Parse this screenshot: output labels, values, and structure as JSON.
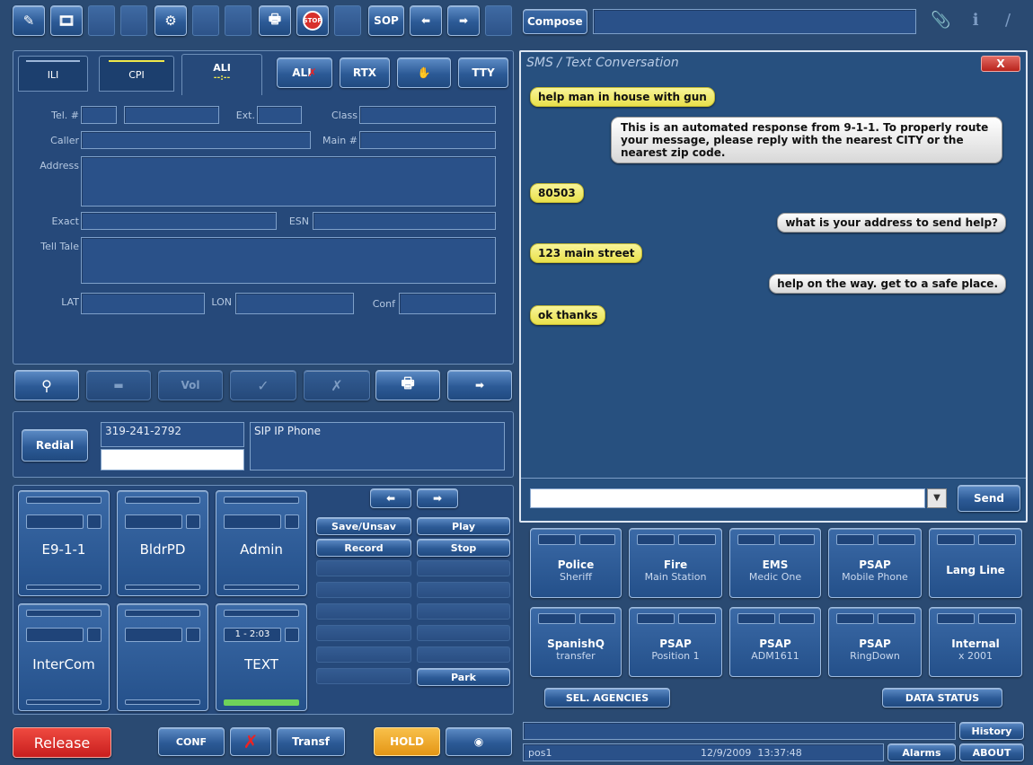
{
  "toolbar": {
    "sop_label": "SOP",
    "stop_label": "STOP"
  },
  "compose": {
    "label": "Compose"
  },
  "ali": {
    "tabs": [
      "ILI",
      "CPI",
      "ALI"
    ],
    "buttons": [
      "ALI",
      "RTX",
      "TTY"
    ],
    "labels": {
      "tel": "Tel. #",
      "ext": "Ext.",
      "class": "Class",
      "caller": "Caller",
      "main": "Main #",
      "address": "Address",
      "exact": "Exact",
      "esn": "ESN",
      "telltale": "Tell Tale",
      "lat": "LAT",
      "lon": "LON",
      "conf": "Conf"
    },
    "vol": "Vol"
  },
  "phone": {
    "redial_label": "Redial",
    "number": "319-241-2792",
    "device": "SIP IP Phone"
  },
  "lines": [
    {
      "label": "E9-1-1"
    },
    {
      "label": "BldrPD"
    },
    {
      "label": "Admin"
    },
    {
      "label": "InterCom"
    },
    {
      "label": ""
    },
    {
      "label": "TEXT",
      "timer": "1 - 2:03"
    }
  ],
  "recorder": {
    "save": "Save/Unsav",
    "play": "Play",
    "record": "Record",
    "stop": "Stop",
    "park": "Park"
  },
  "bottom_left": {
    "release": "Release",
    "conf": "CONF",
    "transf": "Transf",
    "hold": "HOLD"
  },
  "sms": {
    "title": "SMS / Text Conversation",
    "close": "X",
    "send_label": "Send",
    "messages": [
      {
        "from": "caller",
        "text": "help man in house with gun"
      },
      {
        "from": "psap",
        "text": "This is an automated response from 9-1-1. To properly route your message, please reply with the nearest CITY or the nearest zip code."
      },
      {
        "from": "caller",
        "text": "80503"
      },
      {
        "from": "psap",
        "text": "what is your address to send help?"
      },
      {
        "from": "caller",
        "text": "123 main street"
      },
      {
        "from": "psap",
        "text": "help on the way. get to a safe place."
      },
      {
        "from": "caller",
        "text": "ok thanks"
      }
    ]
  },
  "speed_dial": [
    {
      "title": "Police",
      "sub": "Sheriff"
    },
    {
      "title": "Fire",
      "sub": "Main Station"
    },
    {
      "title": "EMS",
      "sub": "Medic One"
    },
    {
      "title": "PSAP",
      "sub": "Mobile Phone"
    },
    {
      "title": "Lang Line",
      "sub": ""
    },
    {
      "title": "SpanishQ",
      "sub": "transfer"
    },
    {
      "title": "PSAP",
      "sub": "Position 1"
    },
    {
      "title": "PSAP",
      "sub": "ADM1611"
    },
    {
      "title": "PSAP",
      "sub": "RingDown"
    },
    {
      "title": "Internal",
      "sub": "x 2001"
    }
  ],
  "agencies": {
    "sel": "SEL. AGENCIES",
    "data_status": "DATA STATUS"
  },
  "status": {
    "history": "History",
    "position": "pos1",
    "datetime": "12/9/2009  13:37:48",
    "alarms": "Alarms",
    "about": "ABOUT"
  },
  "colors": {
    "background": "#2a4a72",
    "caller_bubble": "#f1ec6a",
    "psap_bubble": "#ececec",
    "release": "#d62b2b",
    "hold": "#f0a31e"
  }
}
